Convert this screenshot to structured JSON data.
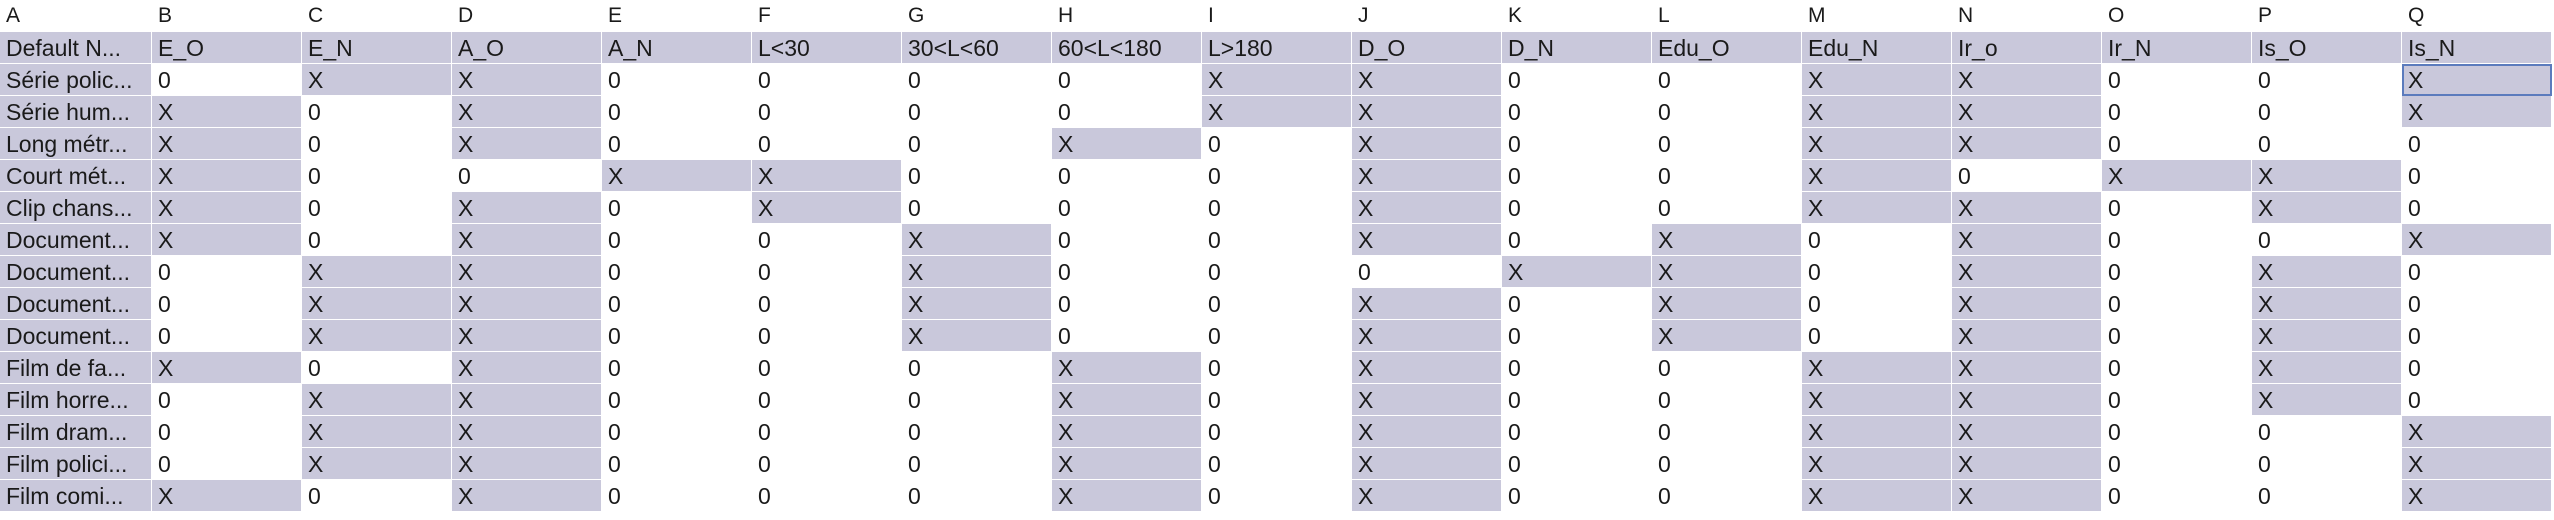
{
  "columns": [
    "A",
    "B",
    "C",
    "D",
    "E",
    "F",
    "G",
    "H",
    "I",
    "J",
    "K",
    "L",
    "M",
    "N",
    "O",
    "P",
    "Q"
  ],
  "corner_label": "Default N...",
  "header_labels": [
    "E_O",
    "E_N",
    "A_O",
    "A_N",
    "L<30",
    "30<L<60",
    "60<L<180",
    "L>180",
    "D_O",
    "D_N",
    "Edu_O",
    "Edu_N",
    "Ir_o",
    "Ir_N",
    "Is_O",
    "Is_N"
  ],
  "selected_cell": {
    "row": 0,
    "col": 15
  },
  "colors": {
    "highlight": "#c9c8db",
    "background": "#ffffff",
    "selection": "#5b7bbd"
  },
  "rows": [
    {
      "label": "Série polic...",
      "values": [
        "0",
        "X",
        "X",
        "0",
        "0",
        "0",
        "0",
        "X",
        "X",
        "0",
        "0",
        "X",
        "X",
        "0",
        "0",
        "X"
      ]
    },
    {
      "label": "Série hum...",
      "values": [
        "X",
        "0",
        "X",
        "0",
        "0",
        "0",
        "0",
        "X",
        "X",
        "0",
        "0",
        "X",
        "X",
        "0",
        "0",
        "X"
      ]
    },
    {
      "label": "Long métr...",
      "values": [
        "X",
        "0",
        "X",
        "0",
        "0",
        "0",
        "X",
        "0",
        "X",
        "0",
        "0",
        "X",
        "X",
        "0",
        "0",
        "0"
      ]
    },
    {
      "label": "Court mét...",
      "values": [
        "X",
        "0",
        "0",
        "X",
        "X",
        "0",
        "0",
        "0",
        "X",
        "0",
        "0",
        "X",
        "0",
        "X",
        "X",
        "0"
      ]
    },
    {
      "label": "Clip chans...",
      "values": [
        "X",
        "0",
        "X",
        "0",
        "X",
        "0",
        "0",
        "0",
        "X",
        "0",
        "0",
        "X",
        "X",
        "0",
        "X",
        "0"
      ]
    },
    {
      "label": "Document...",
      "values": [
        "X",
        "0",
        "X",
        "0",
        "0",
        "X",
        "0",
        "0",
        "X",
        "0",
        "X",
        "0",
        "X",
        "0",
        "0",
        "X"
      ]
    },
    {
      "label": "Document...",
      "values": [
        "0",
        "X",
        "X",
        "0",
        "0",
        "X",
        "0",
        "0",
        "0",
        "X",
        "X",
        "0",
        "X",
        "0",
        "X",
        "0"
      ]
    },
    {
      "label": "Document...",
      "values": [
        "0",
        "X",
        "X",
        "0",
        "0",
        "X",
        "0",
        "0",
        "X",
        "0",
        "X",
        "0",
        "X",
        "0",
        "X",
        "0"
      ]
    },
    {
      "label": "Document...",
      "values": [
        "0",
        "X",
        "X",
        "0",
        "0",
        "X",
        "0",
        "0",
        "X",
        "0",
        "X",
        "0",
        "X",
        "0",
        "X",
        "0"
      ]
    },
    {
      "label": "Film de fa...",
      "values": [
        "X",
        "0",
        "X",
        "0",
        "0",
        "0",
        "X",
        "0",
        "X",
        "0",
        "0",
        "X",
        "X",
        "0",
        "X",
        "0"
      ]
    },
    {
      "label": "Film horre...",
      "values": [
        "0",
        "X",
        "X",
        "0",
        "0",
        "0",
        "X",
        "0",
        "X",
        "0",
        "0",
        "X",
        "X",
        "0",
        "X",
        "0"
      ]
    },
    {
      "label": "Film dram...",
      "values": [
        "0",
        "X",
        "X",
        "0",
        "0",
        "0",
        "X",
        "0",
        "X",
        "0",
        "0",
        "X",
        "X",
        "0",
        "0",
        "X"
      ]
    },
    {
      "label": "Film polici...",
      "values": [
        "0",
        "X",
        "X",
        "0",
        "0",
        "0",
        "X",
        "0",
        "X",
        "0",
        "0",
        "X",
        "X",
        "0",
        "0",
        "X"
      ]
    },
    {
      "label": "Film comi...",
      "values": [
        "X",
        "0",
        "X",
        "0",
        "0",
        "0",
        "X",
        "0",
        "X",
        "0",
        "0",
        "X",
        "X",
        "0",
        "0",
        "X"
      ]
    }
  ]
}
